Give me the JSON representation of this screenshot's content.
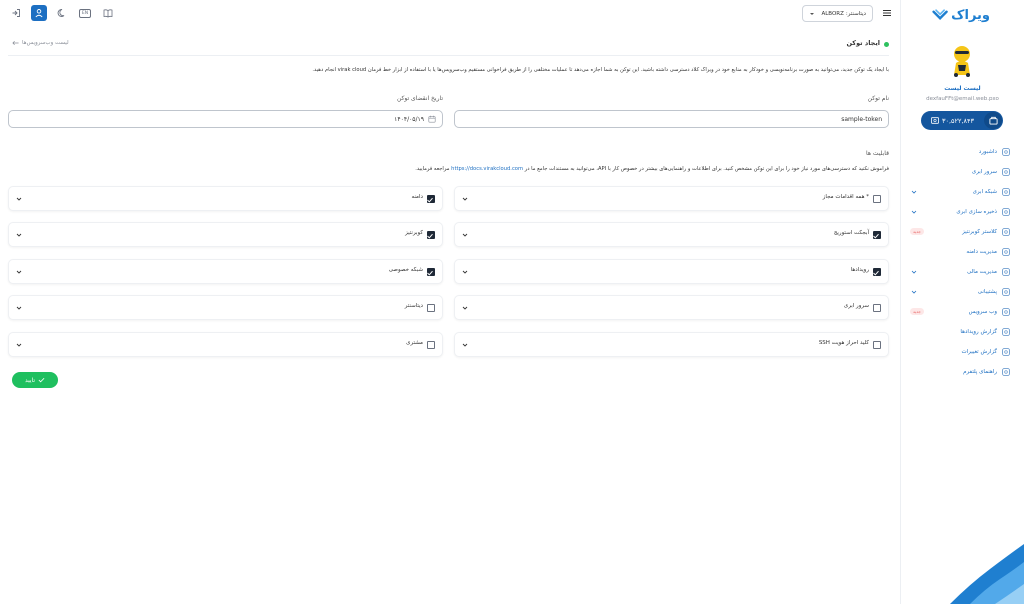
{
  "sidebar": {
    "logo_text": "ویراک",
    "user_name": "لیست لیست",
    "user_email": "dexfauFFt@email.web.pxo",
    "balance": "۳۰,۵۲۲,۸۴۳",
    "menu": [
      {
        "label": "داشبورد",
        "icon": "dashboard-icon",
        "has_chevron": false,
        "badge": ""
      },
      {
        "label": "سرور ابری",
        "icon": "cloud-icon",
        "has_chevron": false,
        "badge": ""
      },
      {
        "label": "شبکه ابری",
        "icon": "network-icon",
        "has_chevron": true,
        "badge": ""
      },
      {
        "label": "ذخیره سازی ابری",
        "icon": "storage-icon",
        "has_chevron": true,
        "badge": ""
      },
      {
        "label": "کلاستر کوبرنتیز",
        "icon": "kubernetes-icon",
        "has_chevron": false,
        "badge": "جدید"
      },
      {
        "label": "مدیریت دامنه",
        "icon": "domain-icon",
        "has_chevron": false,
        "badge": ""
      },
      {
        "label": "مدیریت مالی",
        "icon": "wallet-icon",
        "has_chevron": true,
        "badge": ""
      },
      {
        "label": "پشتیبانی",
        "icon": "support-icon",
        "has_chevron": true,
        "badge": ""
      },
      {
        "label": "وب سرویس",
        "icon": "webservice-icon",
        "has_chevron": false,
        "badge": "جدید"
      },
      {
        "label": "گزارش رویدادها",
        "icon": "events-icon",
        "has_chevron": false,
        "badge": ""
      },
      {
        "label": "گزارش تغییرات",
        "icon": "changelog-icon",
        "has_chevron": false,
        "badge": ""
      },
      {
        "label": "راهنمای پلتفرم",
        "icon": "book-icon",
        "has_chevron": false,
        "badge": ""
      }
    ]
  },
  "topbar": {
    "region_prefix": "دیتاسنتر:",
    "region_value": "ALBORZ",
    "lang_label": "EN"
  },
  "page": {
    "title": "ایجاد توکن",
    "back_link": "لیست وب‌سرویس‌ها",
    "description": "با ایجاد یک توکن جدید، می‌توانید به صورت برنامه‌نویسی و خودکار به منابع خود در ویراک کلاد دسترسی داشته باشید. این توکن به شما اجازه می‌دهد تا عملیات مختلفی را از طریق فراخوانی مستقیم وب‌سرویس‌ها یا با استفاده از ابزار خط فرمان virak cloud انجام دهید.",
    "token_name_label": "نام توکن",
    "token_name_value": "sample-token",
    "expiry_label": "تاریخ انقضای توکن",
    "expiry_value": "۱۴۰۴/۰۵/۱۹",
    "capabilities_title": "قابلیت ها",
    "notice_prefix": "فراموش نکنید که دسترسی‌های مورد نیاز خود را برای این توکن مشخص کنید. برای اطلاعات و راهنمایی‌های بیشتر در خصوص کار با API، می‌توانید به مستندات جامع ما در",
    "notice_link": "https://docs.virakcloud.com",
    "notice_suffix": "مراجعه فرمایید.",
    "confirm_label": "تایید"
  },
  "permissions": {
    "right": [
      {
        "label": "* همه اقدامات مجاز",
        "checked": false
      },
      {
        "label": "آبجکت استوریج",
        "checked": true
      },
      {
        "label": "رویدادها",
        "checked": true
      },
      {
        "label": "سرور ابری",
        "checked": false
      },
      {
        "label": "کلید احراز هویت SSH",
        "checked": false
      }
    ],
    "left": [
      {
        "label": "دامنه",
        "checked": true
      },
      {
        "label": "کوبرنتیز",
        "checked": true
      },
      {
        "label": "شبکه خصوصی",
        "checked": true
      },
      {
        "label": "دیتاسنتر",
        "checked": false
      },
      {
        "label": "مشتری",
        "checked": false
      }
    ]
  },
  "colors": {
    "primary": "#1d6fc2",
    "sidebar_balance": "#14569e",
    "success": "#1fbf5f",
    "badge_new": "#fde7e7"
  }
}
